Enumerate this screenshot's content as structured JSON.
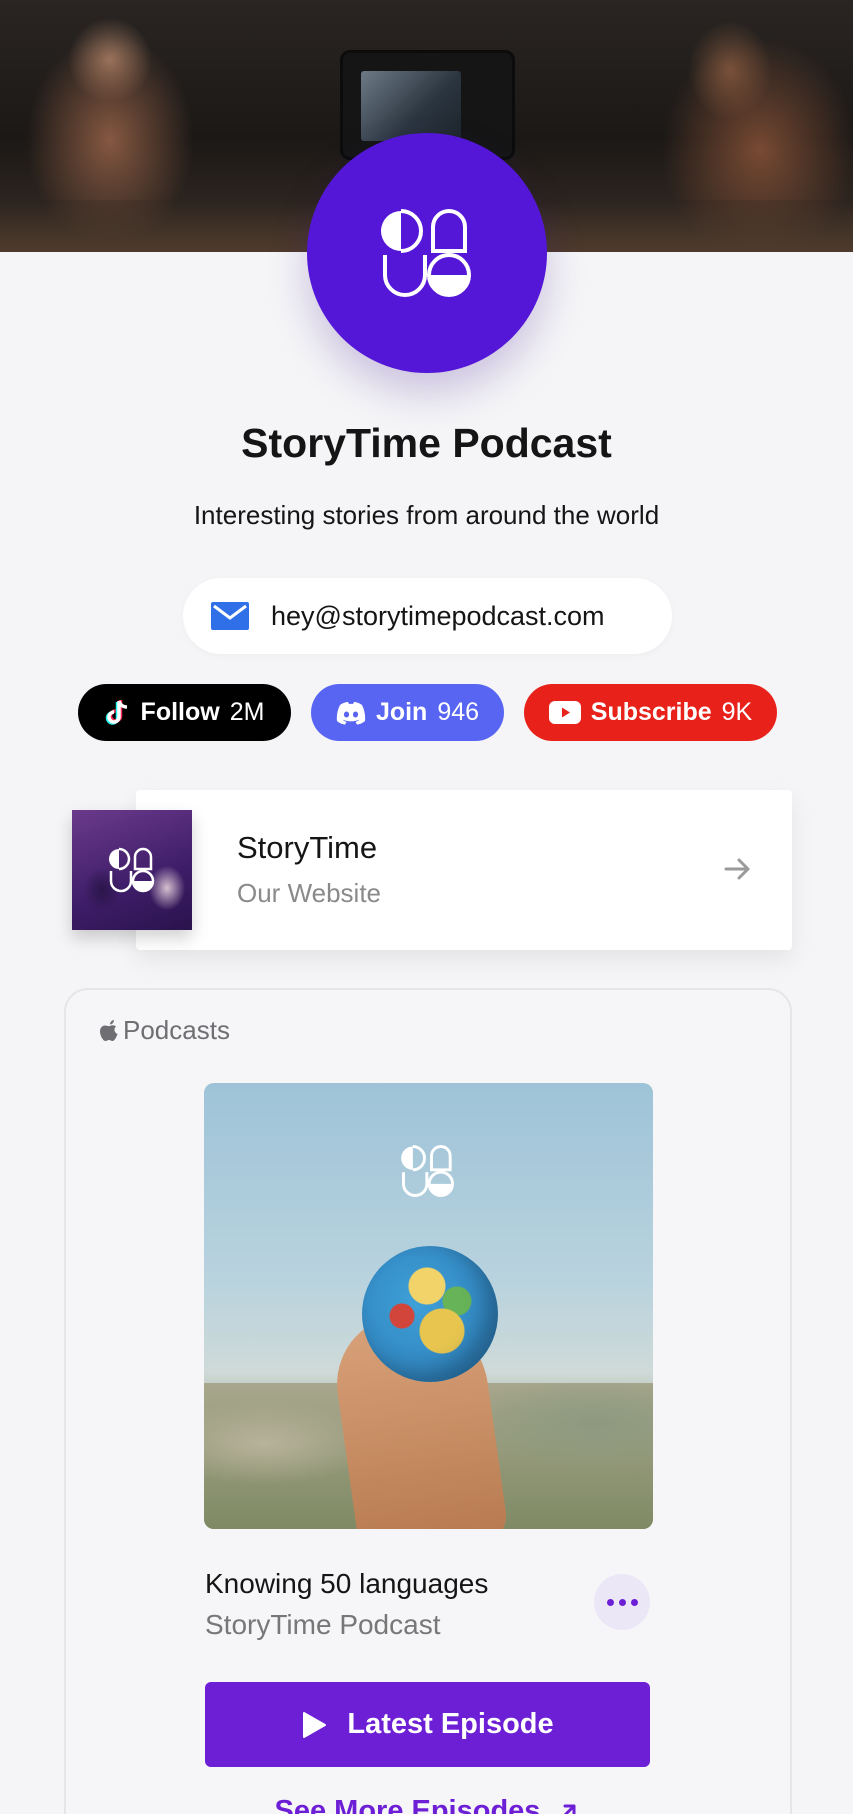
{
  "profile": {
    "name": "StoryTime Podcast",
    "tagline": "Interesting stories from around the world",
    "email": "hey@storytimepodcast.com",
    "accent_color": "#5417d7"
  },
  "socials": [
    {
      "label": "Follow",
      "count": "2M",
      "icon": "tiktok-icon",
      "color": "#000000"
    },
    {
      "label": "Join",
      "count": "946",
      "icon": "discord-icon",
      "color": "#5865f2"
    },
    {
      "label": "Subscribe",
      "count": "9K",
      "icon": "youtube-icon",
      "color": "#e8221b"
    }
  ],
  "website_link": {
    "title": "StoryTime",
    "subtitle": "Our Website",
    "icon": "arrow-right-icon"
  },
  "podcast_embed": {
    "provider": "Podcasts",
    "episode_title": "Knowing 50 languages",
    "show_name": "StoryTime Podcast",
    "primary_button": "Latest Episode",
    "secondary_link": "See More Episodes",
    "button_color": "#6d1fd6"
  }
}
